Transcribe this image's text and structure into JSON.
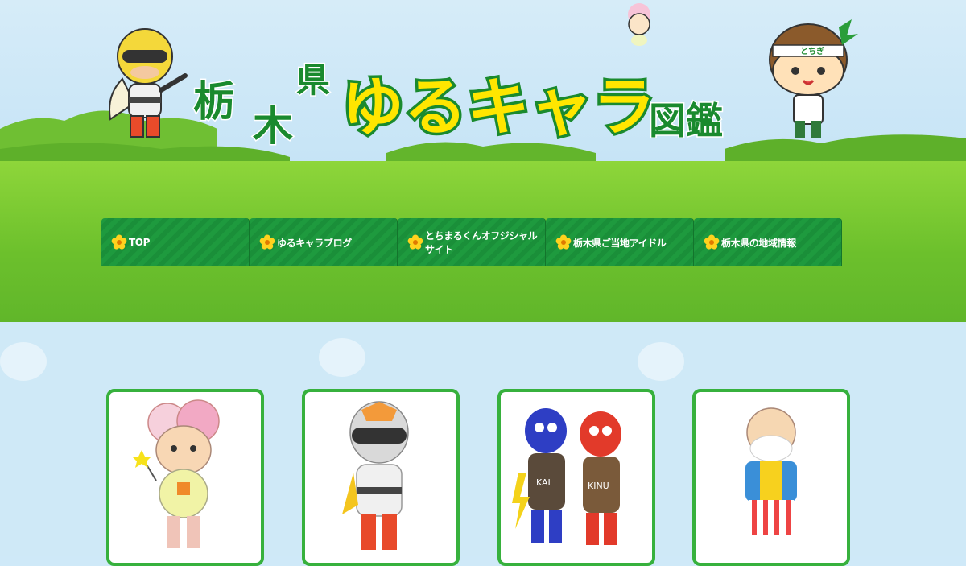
{
  "header": {
    "logo_line1": "栃木県",
    "logo_main": "ゆるキャラ図鑑",
    "mascot_badge": "とちぎ"
  },
  "nav": {
    "items": [
      {
        "label": "TOP"
      },
      {
        "label": "ゆるキャラブログ"
      },
      {
        "label": "とちまるくんオフジシャルサイト"
      },
      {
        "label": "栃木県ご当地アイドル"
      },
      {
        "label": "栃木県の地域情報"
      }
    ]
  },
  "cards": [
    {
      "icon": "flower-girl-mascot"
    },
    {
      "icon": "masked-hero-mascot"
    },
    {
      "icon": "demon-pair-mascot",
      "labels": [
        "KAI",
        "KINU"
      ]
    },
    {
      "icon": "old-man-mascot"
    }
  ],
  "colors": {
    "nav_green": "#1e9a3e",
    "card_border": "#37b13d",
    "logo_green": "#1a8a2e",
    "logo_yellow": "#ffe600"
  }
}
